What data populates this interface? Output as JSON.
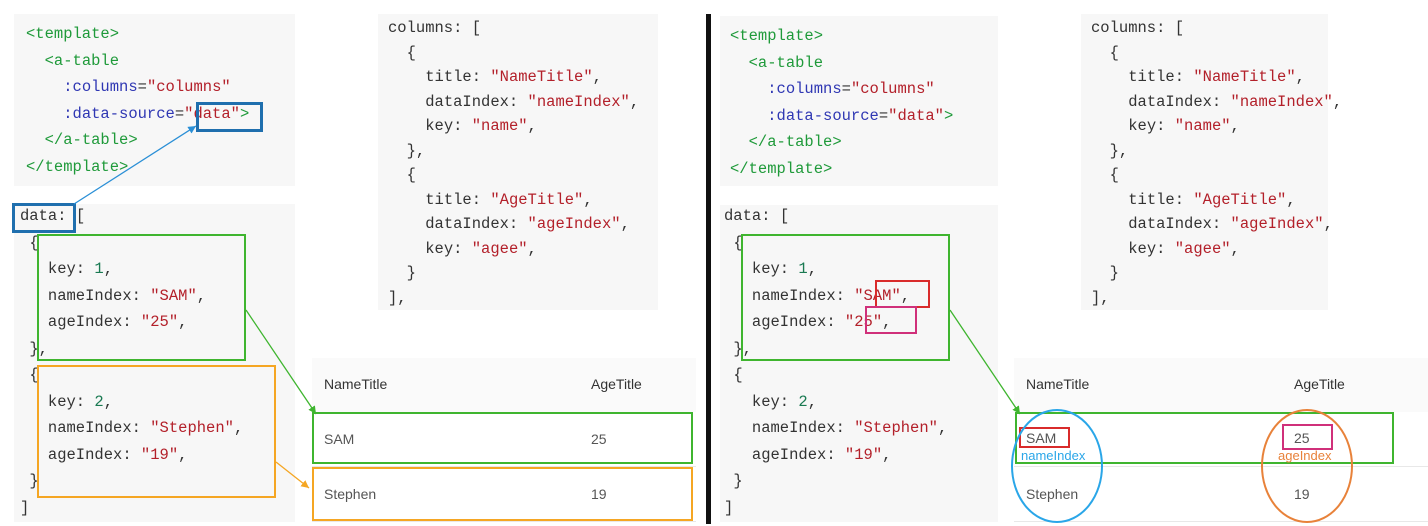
{
  "left": {
    "template": {
      "l1": "<template>",
      "l2": "<a-table",
      "l3_attr": ":columns",
      "l3_val": "\"columns\"",
      "l4_attr": ":data-source",
      "l4_val": "\"data\"",
      "l4_end": ">",
      "l5": "</a-table>",
      "l6": "</template>"
    },
    "data_code": {
      "head": "data:",
      "head_rest": " [",
      "open1": "{",
      "k1": "key: ",
      "k1v": "1",
      "k1c": ",",
      "n1": "nameIndex: ",
      "n1v": "\"SAM\"",
      "n1c": ",",
      "a1": "ageIndex: ",
      "a1v": "\"25\"",
      "a1c": ",",
      "close1": "},",
      "open2": "{",
      "k2": "key: ",
      "k2v": "2",
      "k2c": ",",
      "n2": "nameIndex: ",
      "n2v": "\"Stephen\"",
      "n2c": ",",
      "a2": "ageIndex: ",
      "a2v": "\"19\"",
      "a2c": ",",
      "close2": "}",
      "end": "]"
    },
    "columns_code": {
      "head": "columns: [",
      "o1": "{",
      "t1": "title: ",
      "t1v": "\"NameTitle\"",
      "d1": "dataIndex: ",
      "d1v": "\"nameIndex\"",
      "key1": "key: ",
      "key1v": "\"name\"",
      "c1": "},",
      "o2": "{",
      "t2": "title: ",
      "t2v": "\"AgeTitle\"",
      "d2": "dataIndex: ",
      "d2v": "\"ageIndex\"",
      "key2": "key: ",
      "key2v": "\"agee\"",
      "c2": "}",
      "end": "],",
      "comma": ","
    },
    "table": {
      "col1": "NameTitle",
      "col2": "AgeTitle",
      "rows": [
        {
          "name": "SAM",
          "age": "25"
        },
        {
          "name": "Stephen",
          "age": "19"
        }
      ]
    }
  },
  "right": {
    "table": {
      "col1": "NameTitle",
      "col2": "AgeTitle",
      "rows": [
        {
          "name": "SAM",
          "age": "25"
        },
        {
          "name": "Stephen",
          "age": "19"
        }
      ],
      "label_name": "nameIndex",
      "label_age": "ageIndex"
    }
  },
  "colors": {
    "green": "#3fb52f",
    "orange": "#f5a623",
    "blue": "#1f6fae",
    "red": "#d92b2b",
    "pink": "#d0307a",
    "cyan": "#2aa6e8",
    "ring_orange": "#e8823a"
  }
}
